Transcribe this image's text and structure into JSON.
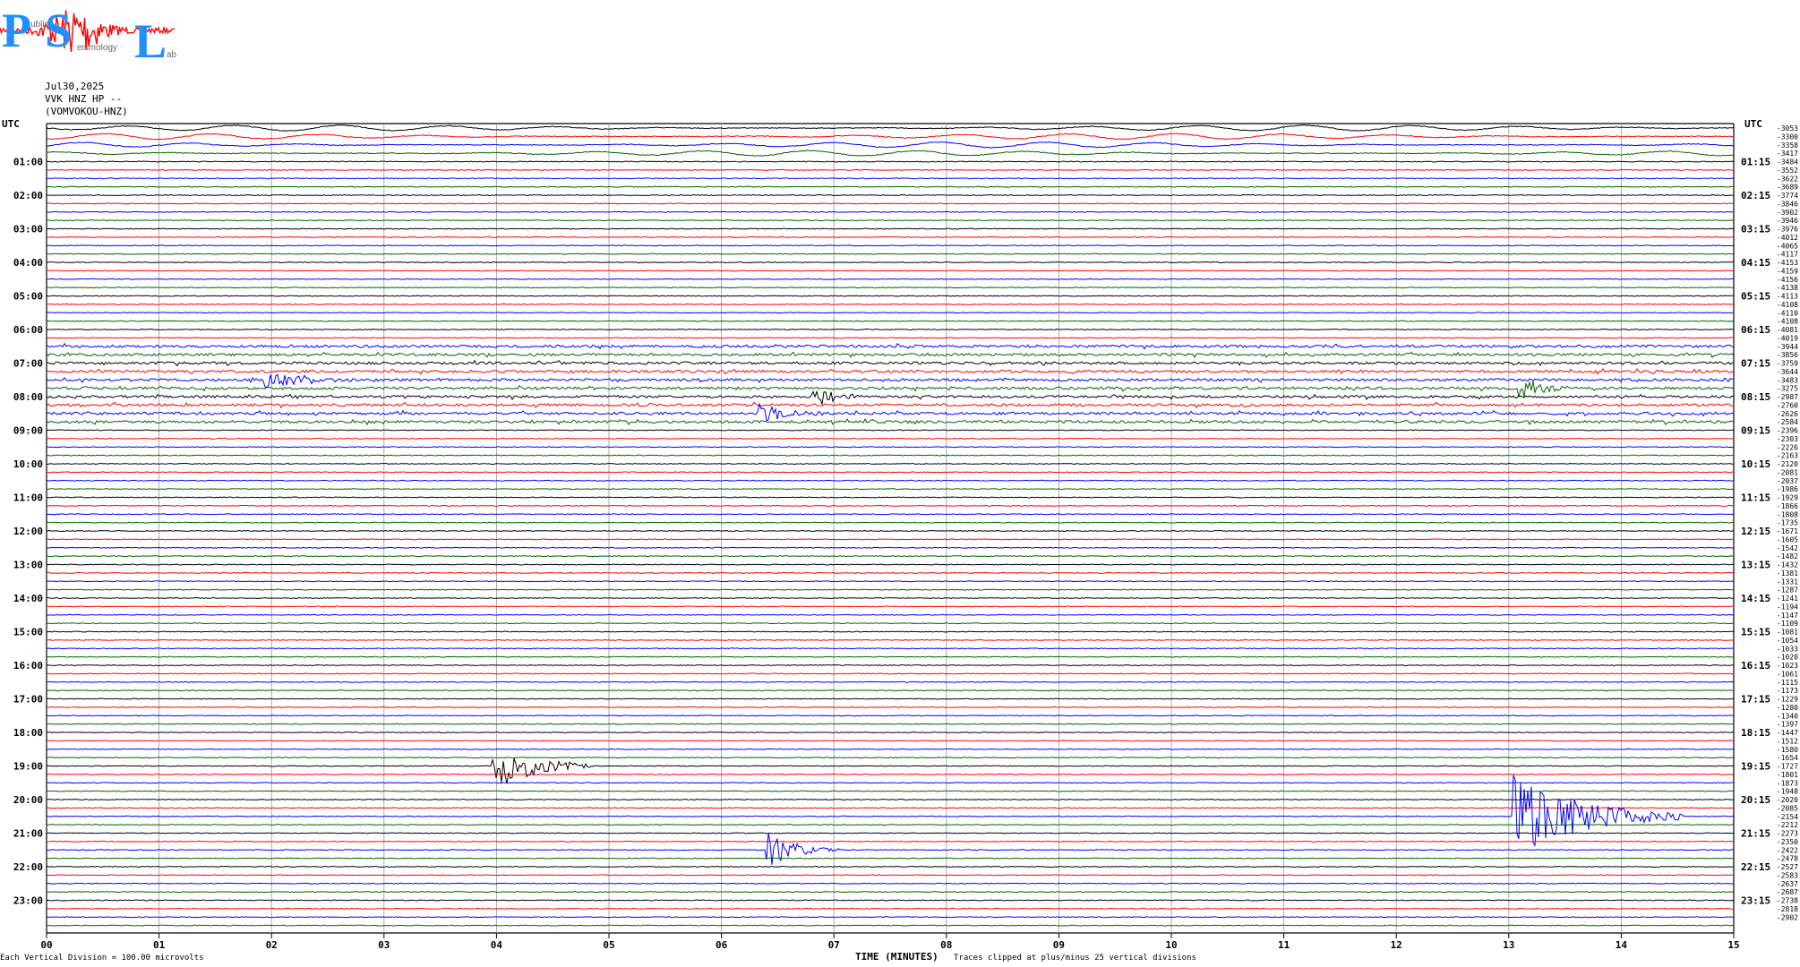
{
  "logo": {
    "big_letters": [
      "P",
      "S",
      "L"
    ],
    "small_words": [
      "ublic",
      "eismology",
      "ab"
    ],
    "colors": {
      "letters": "#1e90ff",
      "wave": "#ff0000",
      "small": "#555555"
    }
  },
  "header": {
    "date": "Jul30,2025",
    "channel": "VVK HNZ HP --",
    "station": "(VOMVOKOU-HNZ)"
  },
  "axis": {
    "left_utc": "UTC",
    "right_utc": "UTC",
    "left_hours": [
      "01:00",
      "02:00",
      "03:00",
      "04:00",
      "05:00",
      "06:00",
      "07:00",
      "08:00",
      "09:00",
      "10:00",
      "11:00",
      "12:00",
      "13:00",
      "14:00",
      "15:00",
      "16:00",
      "17:00",
      "18:00",
      "19:00",
      "20:00",
      "21:00",
      "22:00",
      "23:00"
    ],
    "right_hours": [
      "01:15",
      "02:15",
      "03:15",
      "04:15",
      "05:15",
      "06:15",
      "07:15",
      "08:15",
      "09:15",
      "10:15",
      "11:15",
      "12:15",
      "13:15",
      "14:15",
      "15:15",
      "16:15",
      "17:15",
      "18:15",
      "19:15",
      "20:15",
      "21:15",
      "22:15",
      "23:15"
    ],
    "minute_ticks": [
      "00",
      "01",
      "02",
      "03",
      "04",
      "05",
      "06",
      "07",
      "08",
      "09",
      "10",
      "11",
      "12",
      "13",
      "14",
      "15"
    ],
    "xlabel": "TIME (MINUTES)"
  },
  "footer": {
    "scale_note": "Each Vertical Division =  100.00 microvolts",
    "clip_note": "Traces clipped at plus/minus 25 vertical divisions"
  },
  "chart_data": {
    "type": "line",
    "title": "",
    "xlabel": "TIME (MINUTES)",
    "ylabel": "",
    "xlim": [
      0,
      15
    ],
    "rows": 96,
    "minutes_per_row": 15,
    "grid": true,
    "color_cycle": [
      "#000000",
      "#ff0000",
      "#0000ff",
      "#006400"
    ],
    "line_offsets": [
      "-3053",
      "-3300",
      "-3358",
      "-3417",
      "-3484",
      "-3552",
      "-3622",
      "-3689",
      "-3774",
      "-3846",
      "-3902",
      "-3946",
      "-3976",
      "-4012",
      "-4065",
      "-4117",
      "-4153",
      "-4159",
      "-4156",
      "-4138",
      "-4113",
      "-4108",
      "-4110",
      "-4108",
      "-4081",
      "-4019",
      "-3944",
      "-3856",
      "-3759",
      "-3644",
      "-3483",
      "-3275",
      "-2987",
      "-2760",
      "-2626",
      "-2584",
      "-2396",
      "-2303",
      "-2226",
      "-2163",
      "-2120",
      "-2081",
      "-2037",
      "-1986",
      "-1929",
      "-1866",
      "-1808",
      "-1735",
      "-1671",
      "-1605",
      "-1542",
      "-1482",
      "-1432",
      "-1381",
      "-1331",
      "-1287",
      "-1241",
      "-1194",
      "-1147",
      "-1109",
      "-1081",
      "-1054",
      "-1033",
      "-1020",
      "-1023",
      "-1061",
      "-1115",
      "-1173",
      "-1229",
      "-1280",
      "-1340",
      "-1397",
      "-1447",
      "-1512",
      "-1580",
      "-1654",
      "-1727",
      "-1801",
      "-1873",
      "-1948",
      "-2020",
      "-2085",
      "-2154",
      "-2212",
      "-2273",
      "-2350",
      "-2422",
      "-2478",
      "-2527",
      "-2583",
      "-2637",
      "-2687",
      "-2738",
      "-2818",
      "-2902"
    ],
    "events": [
      {
        "row": 76,
        "minute": 3.98,
        "amplitude": 3.0,
        "duration": 0.35
      },
      {
        "row": 86,
        "minute": 6.42,
        "amplitude": 2.2,
        "duration": 0.25
      },
      {
        "row": 82,
        "minute": 13.05,
        "amplitude": 5.0,
        "duration": 0.6
      },
      {
        "row": 34,
        "minute": 6.32,
        "amplitude": 1.6,
        "duration": 0.25
      },
      {
        "row": 32,
        "minute": 6.82,
        "amplitude": 1.2,
        "duration": 0.2
      },
      {
        "row": 31,
        "minute": 13.1,
        "amplitude": 1.2,
        "duration": 0.25
      },
      {
        "row": 30,
        "minute": 1.95,
        "amplitude": 1.0,
        "duration": 0.4
      }
    ],
    "noisy_rows": [
      26,
      27,
      28,
      29,
      30,
      31,
      32,
      33,
      34,
      35
    ],
    "long_period_rows": [
      0,
      1,
      2,
      3
    ]
  }
}
